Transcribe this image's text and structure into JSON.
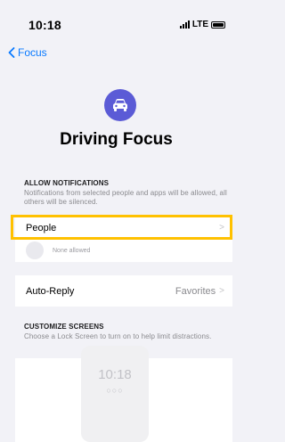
{
  "status_bar": {
    "time": "10:18",
    "network": "LTE"
  },
  "nav": {
    "back_label": "Focus"
  },
  "header": {
    "icon": "car-icon",
    "title": "Driving Focus",
    "accent_color": "#5b5bd6"
  },
  "allow_notifications": {
    "heading": "ALLOW NOTIFICATIONS",
    "description": "Notifications from selected people and apps will be allowed, all others will be silenced.",
    "people_label": "People",
    "none_allowed": "None allowed",
    "auto_reply_label": "Auto-Reply",
    "auto_reply_value": "Favorites"
  },
  "customize_screens": {
    "heading": "CUSTOMIZE SCREENS",
    "description": "Choose a Lock Screen to turn on to help limit distractions.",
    "lock_time": "10:18",
    "lock_dots": "○○○"
  },
  "colors": {
    "link": "#0a7aff",
    "highlight": "#ffc100"
  }
}
